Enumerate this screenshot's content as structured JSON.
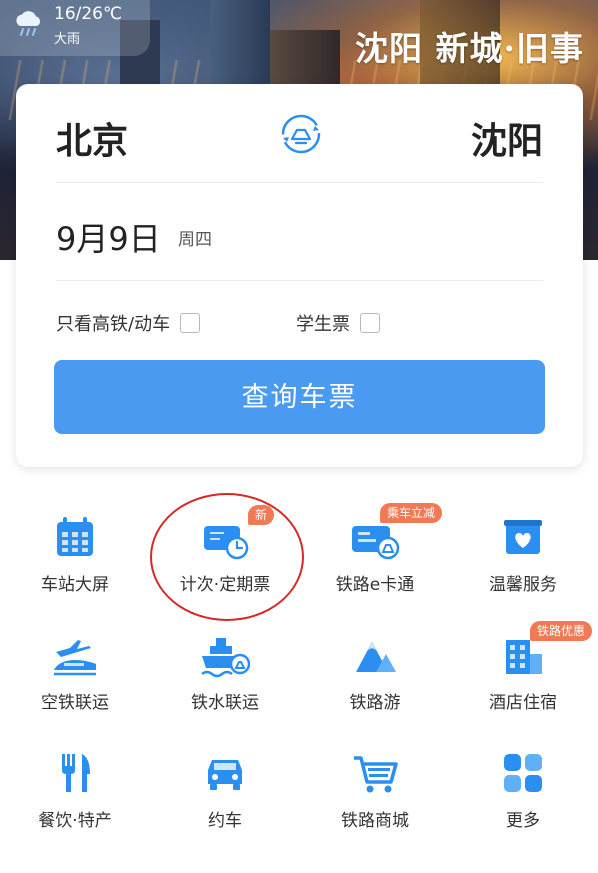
{
  "header": {
    "weather_icon": "rain-cloud-icon",
    "temperature": "16/26℃",
    "condition": "大雨",
    "slogan": "沈阳 新城·旧事"
  },
  "search": {
    "from_city": "北京",
    "to_city": "沈阳",
    "swap_icon": "swap-stations-icon",
    "date": "9月9日",
    "weekday": "周四",
    "option_highspeed": "只看高铁/动车",
    "option_student": "学生票",
    "button_label": "查询车票"
  },
  "colors": {
    "primary": "#4a9af2",
    "icon_blue": "#2a8ff0",
    "badge_orange": "#f07a55",
    "highlight_red": "#d42a25"
  },
  "services": [
    {
      "label": "车站大屏",
      "icon": "calendar-board-icon"
    },
    {
      "label": "计次·定期票",
      "icon": "ticket-clock-icon",
      "badge": "新"
    },
    {
      "label": "铁路e卡通",
      "icon": "rail-card-icon",
      "badge": "乘车立减"
    },
    {
      "label": "温馨服务",
      "icon": "heart-box-icon"
    },
    {
      "label": "空铁联运",
      "icon": "plane-train-icon"
    },
    {
      "label": "铁水联运",
      "icon": "ship-train-icon"
    },
    {
      "label": "铁路游",
      "icon": "mountain-icon"
    },
    {
      "label": "酒店住宿",
      "icon": "hotel-building-icon",
      "badge": "铁路优惠"
    },
    {
      "label": "餐饮·特产",
      "icon": "fork-knife-icon"
    },
    {
      "label": "约车",
      "icon": "car-icon"
    },
    {
      "label": "铁路商城",
      "icon": "shopping-cart-icon"
    },
    {
      "label": "更多",
      "icon": "more-grid-icon"
    }
  ]
}
